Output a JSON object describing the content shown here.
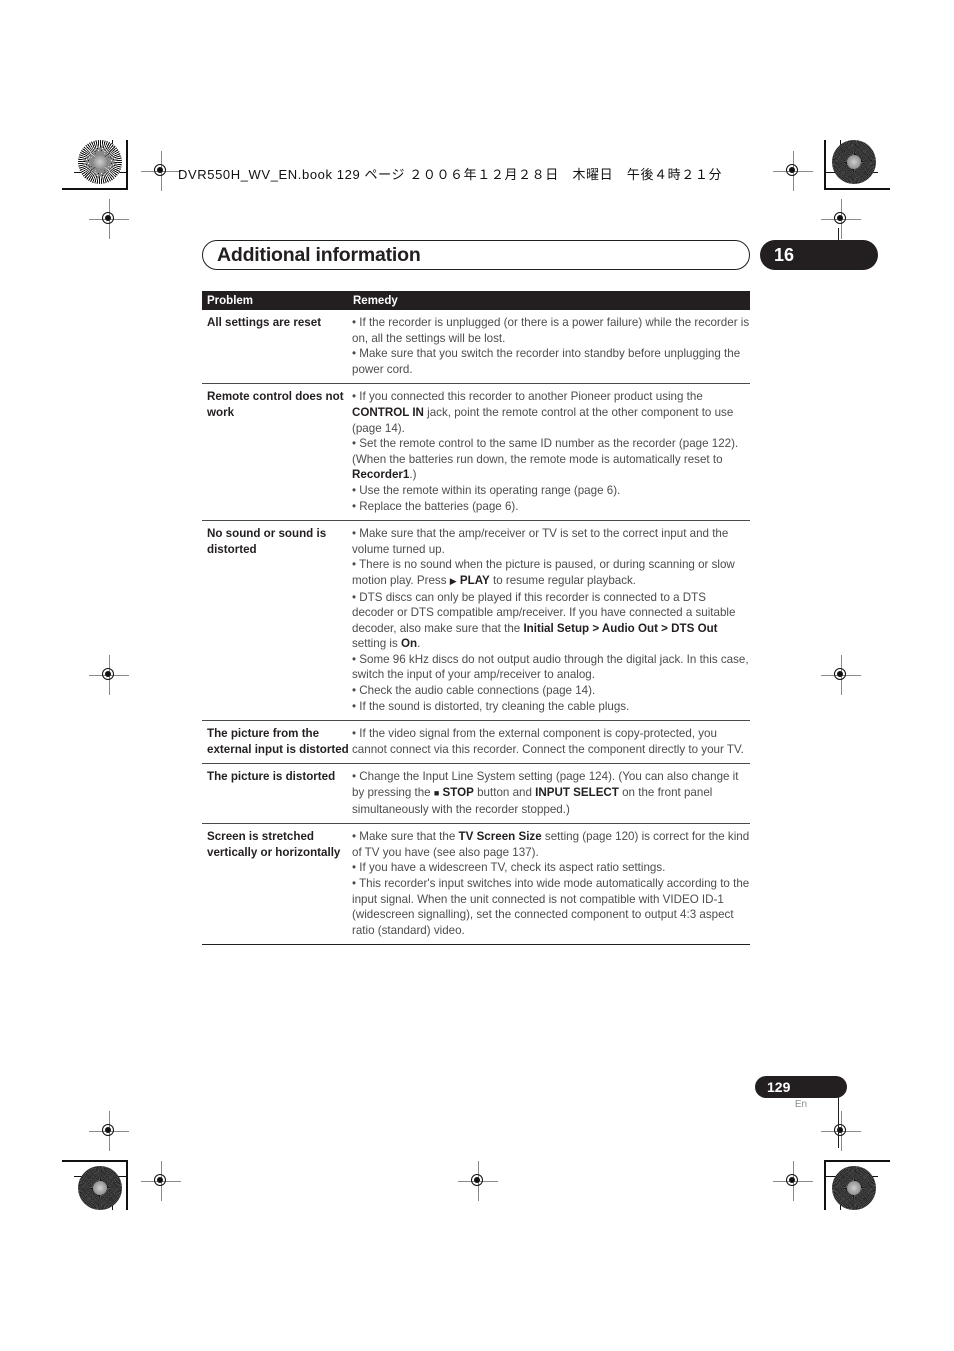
{
  "running_head": "DVR550H_WV_EN.book 129 ページ ２００６年１２月２８日　木曜日　午後４時２１分",
  "chapter": {
    "title": "Additional information",
    "number": "16"
  },
  "table": {
    "headers": {
      "problem": "Problem",
      "remedy": "Remedy"
    },
    "rows": [
      {
        "problem": "All settings are reset",
        "remedy_html": "• If the recorder is unplugged (or there is a power failure) while the recorder is on, all the settings will be lost.<br>• Make sure that you switch the recorder into standby before unplugging the power cord."
      },
      {
        "problem": "Remote control does not work",
        "remedy_html": "• If you connected this recorder to another Pioneer product using the <span class=\"b\">CONTROL IN</span> jack, point the remote control at the other component to use (page 14).<br>• Set the remote control to the same ID number as the recorder (page 122). (When the batteries run down, the remote mode is automatically reset to <span class=\"b\">Recorder1</span>.)<br>• Use the remote within its operating range (page 6).<br>• Replace the batteries (page 6)."
      },
      {
        "problem": "No sound or sound is distorted",
        "remedy_html": "• Make sure that the amp/receiver or TV is set to the correct input and the volume turned up.<br>• There is no sound when the picture is paused, or during scanning or slow motion play. Press <span class=\"glyph\">▶</span> <span class=\"b\">PLAY</span> to resume regular playback.<br>• DTS discs can only be played if this recorder is connected to a DTS decoder or DTS compatible amp/receiver. If you have connected a suitable decoder, also make sure that the <span class=\"b\">Initial Setup &gt; Audio Out &gt; DTS Out</span> setting is <span class=\"b\">On</span>.<br>• Some 96 kHz discs do not output audio through the digital jack. In this case, switch the input of your amp/receiver to analog.<br>• Check the audio cable connections (page 14).<br>• If the sound is distorted, try cleaning the cable plugs."
      },
      {
        "problem": "The picture from the external input is distorted",
        "remedy_html": "• If the video signal from the external component is copy-protected, you cannot connect via this recorder. Connect the component directly to your TV."
      },
      {
        "problem": "The picture is distorted",
        "remedy_html": "• Change the Input Line System setting (page 124). (You can also change it by pressing the <span class=\"glyph\">■</span> <span class=\"b\">STOP</span> button and <span class=\"b\">INPUT SELECT</span> on the front panel simultaneously with the recorder stopped.)"
      },
      {
        "problem": "Screen is stretched vertically or horizontally",
        "remedy_html": "• Make sure that the <span class=\"b\">TV Screen Size</span> setting (page 120) is correct for the kind of TV you have (see also page 137).<br>• If you have a widescreen TV, check its aspect ratio settings.<br>• This recorder's input switches into wide mode automatically according to the input signal. When the unit connected is not compatible with VIDEO ID-1 (widescreen signalling), set the connected component to output 4:3 aspect ratio (standard) video."
      }
    ]
  },
  "footer": {
    "page_number": "129",
    "language": "En"
  },
  "colors": {
    "ink": "#231f20",
    "body_text": "#4d4d4d",
    "rule": "#4a4a4a"
  }
}
